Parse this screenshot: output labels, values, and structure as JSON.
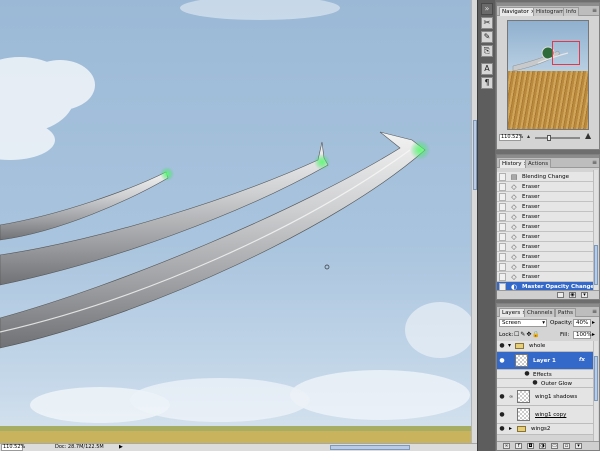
{
  "canvas": {
    "zoom": "110.52%",
    "doc_info": "Doc: 28.7M/122.5M"
  },
  "navigator": {
    "tabs": [
      "Navigator",
      "Histogram",
      "Info"
    ],
    "zoom": "110.52%",
    "zoom_level": 0.3
  },
  "history": {
    "tabs": [
      "History",
      "Actions"
    ],
    "items": [
      "Blending Change",
      "Eraser",
      "Eraser",
      "Eraser",
      "Eraser",
      "Eraser",
      "Eraser",
      "Eraser",
      "Eraser",
      "Eraser",
      "Eraser",
      "Master Opacity Change"
    ],
    "selected_index": 11
  },
  "layers": {
    "tabs": [
      "Layers",
      "Channels",
      "Paths"
    ],
    "blend_mode": "Screen",
    "opacity_label": "Opacity:",
    "opacity": "40%",
    "lock_label": "Lock:",
    "fill_label": "Fill:",
    "fill": "100%",
    "group_name": "whole",
    "selected_layer": "Layer 1",
    "fx": "fx",
    "effects_label": "Effects",
    "effect_name": "Outer Glow",
    "layer_shadow": "wing1 shadows",
    "layer_copy": "wing1 copy",
    "group2": "wings2"
  },
  "colors": {
    "selection": "#3569c9",
    "glow": "#35e05a",
    "nav_box": "#e2384a"
  }
}
